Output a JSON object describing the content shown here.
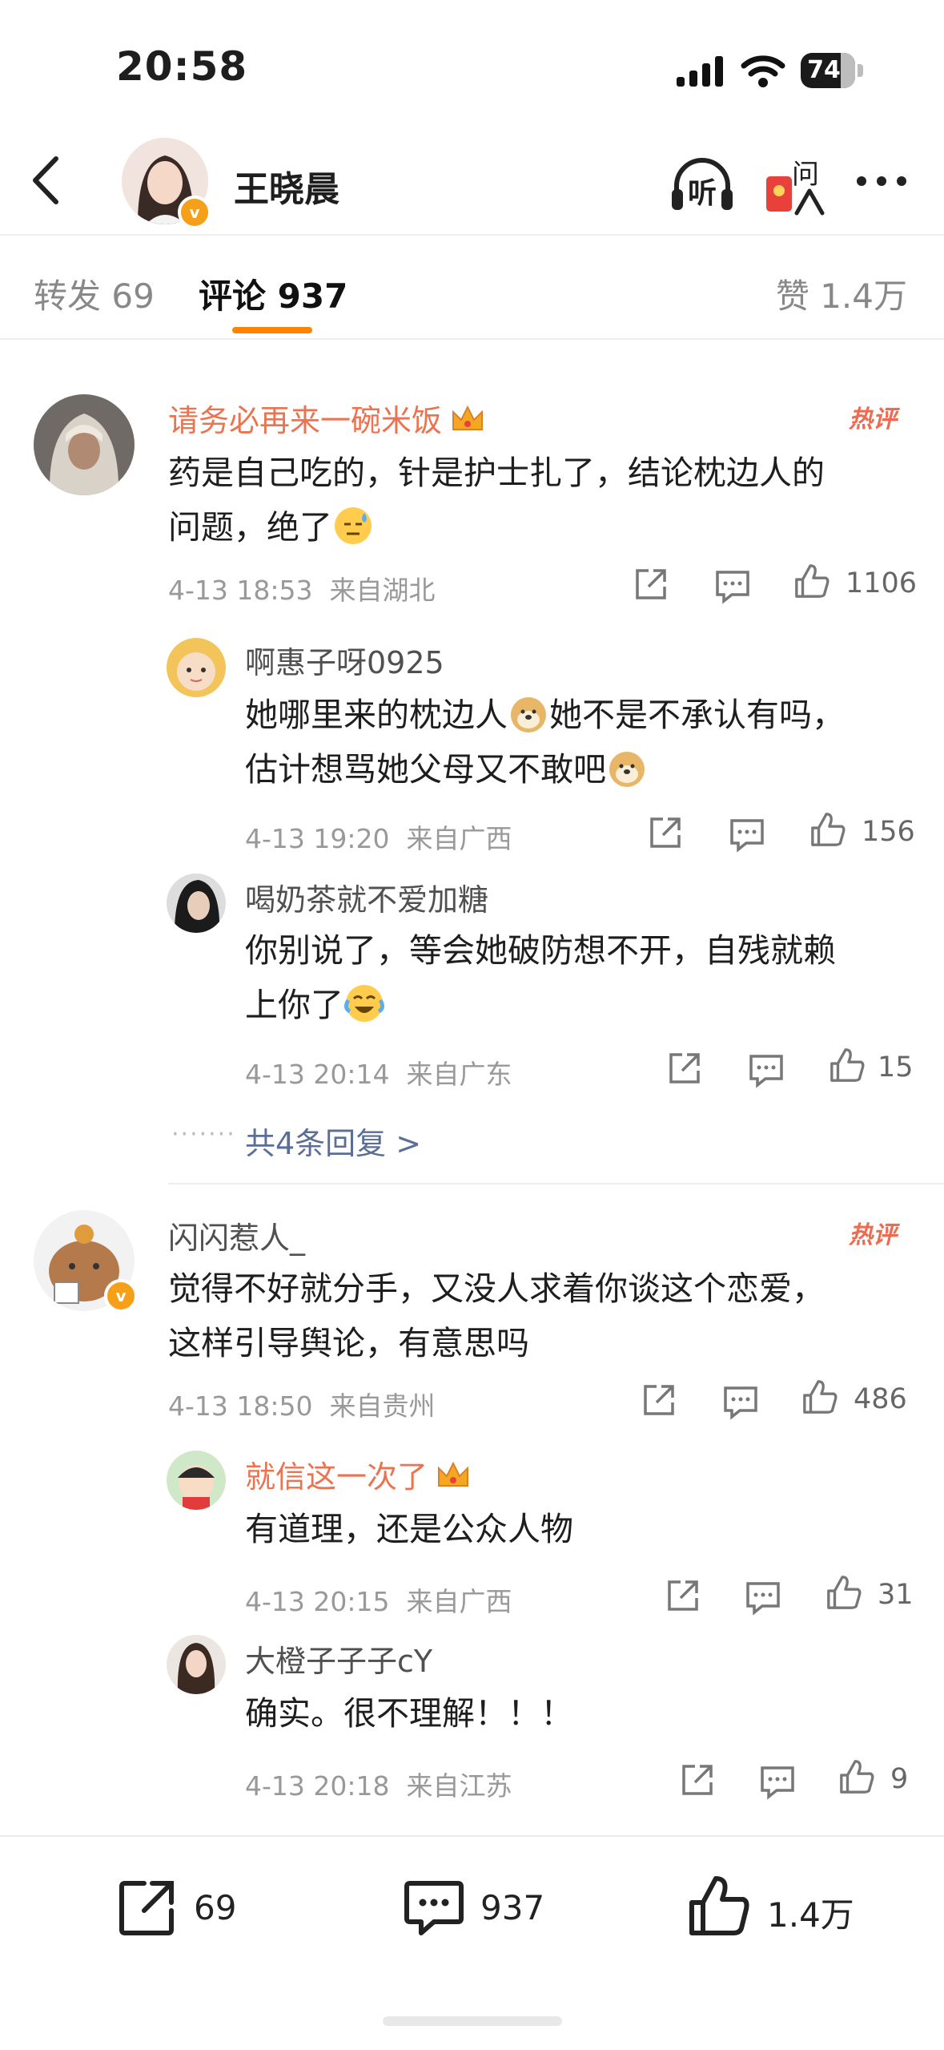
{
  "status": {
    "time": "20:58",
    "battery": "74"
  },
  "nav": {
    "title": "王晓晨",
    "listen_label": "听",
    "ask_label": "问"
  },
  "tabs": {
    "repost": "转发 69",
    "comment": "评论 937",
    "like": "赞 1.4万"
  },
  "hot_label": "热评",
  "comments": [
    {
      "user": "请务必再来一碗米饭",
      "text_line1": "药是自己吃的，针是护士扎了，结论枕边人的",
      "text_line2": "问题，绝了",
      "time": "4-13 18:53",
      "location": "来自湖北",
      "likes": "1106",
      "replies": [
        {
          "user": "啊惠子呀0925",
          "line1a": "她哪里来的枕边人",
          "line1b": "她不是不承认有吗，",
          "line2": "估计想骂她父母又不敢吧",
          "time": "4-13 19:20",
          "location": "来自广西",
          "likes": "156"
        },
        {
          "user": "喝奶茶就不爱加糖",
          "line1": "你别说了，等会她破防想不开，自残就赖",
          "line2": "上你了",
          "time": "4-13 20:14",
          "location": "来自广东",
          "likes": "15"
        }
      ],
      "more_replies": "共4条回复 >"
    },
    {
      "user": "闪闪惹人_",
      "text_line1": "觉得不好就分手，又没人求着你谈这个恋爱，",
      "text_line2": "这样引导舆论，有意思吗",
      "time": "4-13 18:50",
      "location": "来自贵州",
      "likes": "486",
      "replies": [
        {
          "user": "就信这一次了",
          "text": "有道理，还是公众人物",
          "time": "4-13 20:15",
          "location": "来自广西",
          "likes": "31"
        },
        {
          "user": "大橙子子子cY",
          "text": "确实。很不理解！！！",
          "time": "4-13 20:18",
          "location": "来自江苏",
          "likes": "9"
        }
      ]
    }
  ],
  "bottom_bar": {
    "repost": "69",
    "comment": "937",
    "like": "1.4万"
  },
  "icons": {
    "back": "chevron-left-icon",
    "share": "share-icon",
    "comment": "comment-icon",
    "like": "thumbs-up-icon",
    "crown": "crown-icon",
    "more": "more-dots-icon"
  },
  "colors": {
    "accent": "#ff8200",
    "vip_name": "#eb7350",
    "link": "#5b6e96",
    "hot": "#f06a4f"
  }
}
